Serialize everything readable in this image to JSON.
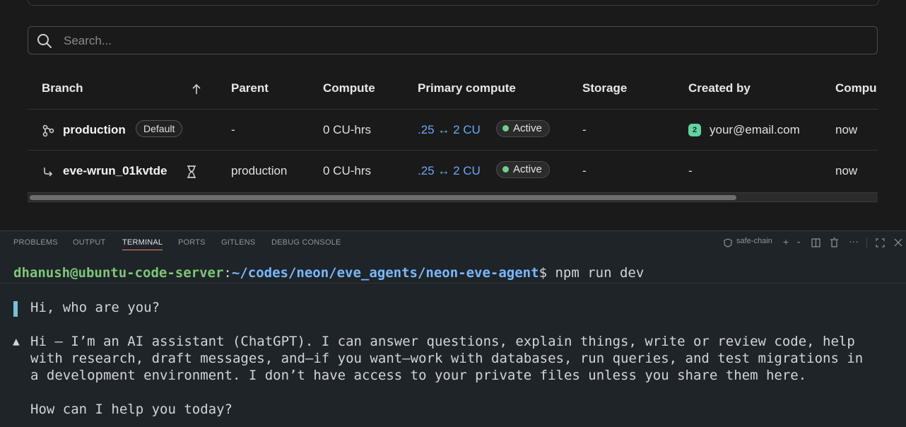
{
  "search": {
    "placeholder": "Search..."
  },
  "table": {
    "headers": [
      "Branch",
      "Parent",
      "Compute",
      "Primary compute",
      "Storage",
      "Created by",
      "Compu"
    ],
    "rows": [
      {
        "branch": "production",
        "badge": "Default",
        "parent": "-",
        "compute": "0 CU-hrs",
        "primary_compute": ".25 ↔ 2 CU",
        "status": "Active",
        "storage": "-",
        "avatar": "2",
        "created_by": "your@email.com",
        "compute_last": "now"
      },
      {
        "branch": "eve-wrun_01kvtde",
        "badge": "",
        "parent": "production",
        "compute": "0 CU-hrs",
        "primary_compute": ".25 ↔ 2 CU",
        "status": "Active",
        "storage": "-",
        "avatar": "",
        "created_by": "-",
        "compute_last": "now"
      }
    ]
  },
  "panel": {
    "tabs": [
      "PROBLEMS",
      "OUTPUT",
      "TERMINAL",
      "PORTS",
      "GITLENS",
      "DEBUG CONSOLE"
    ],
    "active_tab": "TERMINAL",
    "terminal_name": "safe-chain"
  },
  "terminal": {
    "user_host": "dhanush@ubuntu-code-server",
    "colon": ":",
    "path": "~/codes/neon/eve_agents/neon-eve-agent",
    "command": "$ npm run dev",
    "user_message": "Hi, who are you?",
    "assistant_marker": "▲",
    "assistant_lines": [
      "Hi — I’m an AI assistant (ChatGPT). I can answer questions, explain things, write or review code, help",
      "with research, draft messages, and—if you want—work with databases, run queries, and test migrations in",
      "a development environment. I don’t have access to your private files unless you share them here.",
      "",
      "How can I help you today?"
    ]
  },
  "colors": {
    "accent_link": "#6aa7f8",
    "active_dot": "#6fd08c",
    "prompt_user": "#7ec67a",
    "prompt_path": "#79b8ff"
  }
}
